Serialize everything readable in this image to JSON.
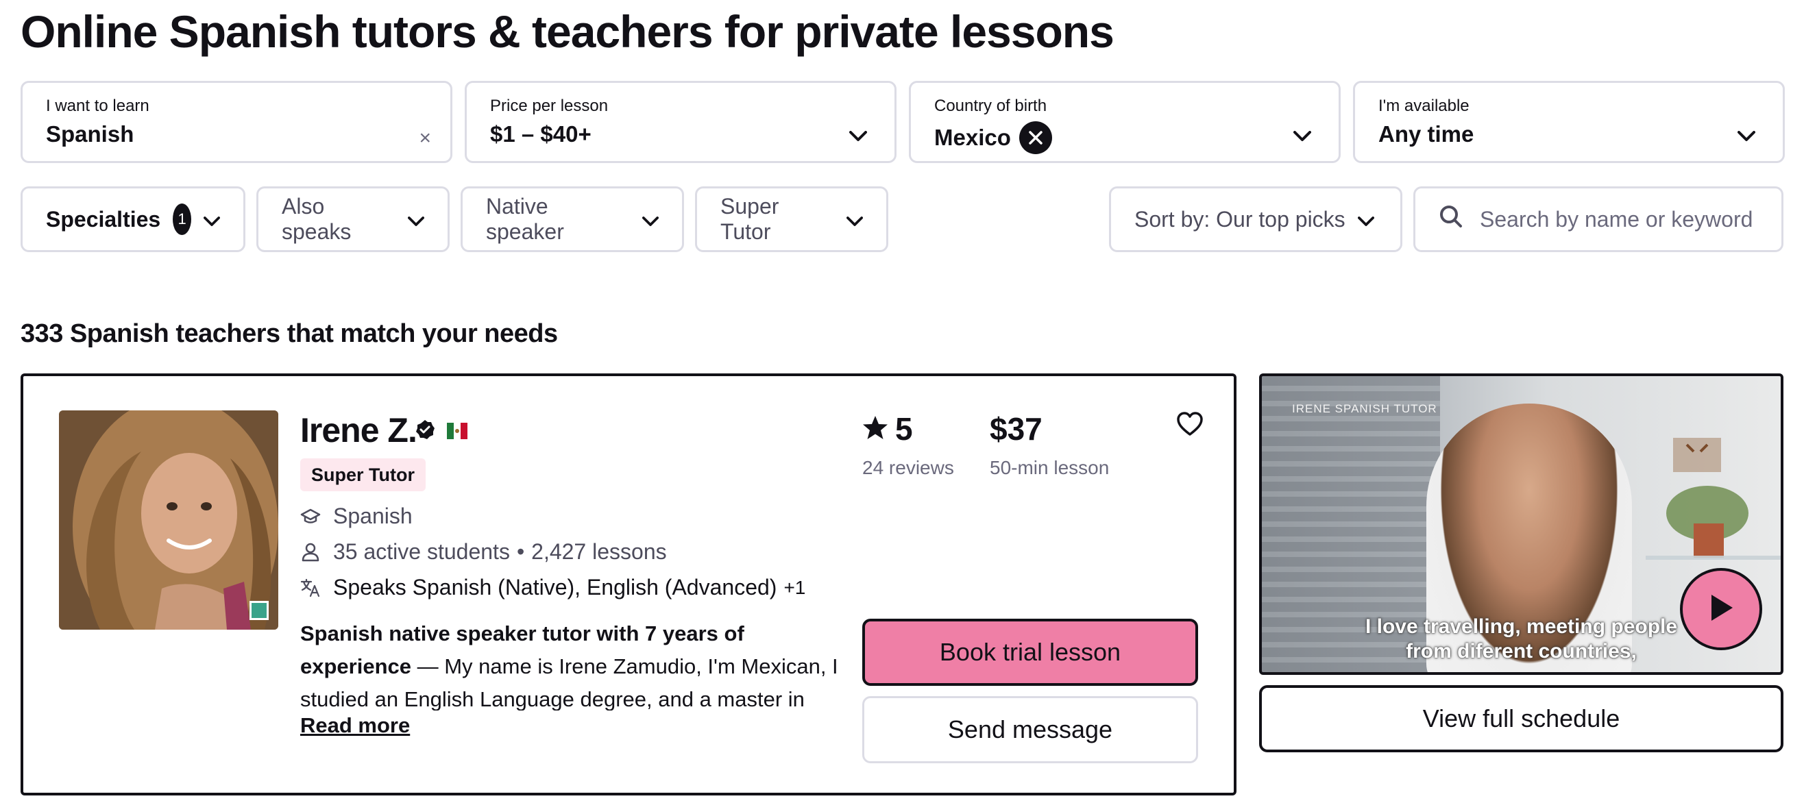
{
  "page": {
    "title": "Online Spanish tutors & teachers for private lessons",
    "match_count_text": "333 Spanish teachers that match your needs"
  },
  "filters": {
    "learn": {
      "label": "I want to learn",
      "value": "Spanish",
      "clear": "×"
    },
    "price": {
      "label": "Price per lesson",
      "value": "$1 – $40+"
    },
    "country": {
      "label": "Country of birth",
      "value": "Mexico"
    },
    "availability": {
      "label": "I'm available",
      "value": "Any time"
    }
  },
  "pills": {
    "specialties": {
      "label": "Specialties",
      "count": "1"
    },
    "also_speaks": "Also speaks",
    "native_speaker": "Native speaker",
    "super_tutor": "Super Tutor",
    "sort": "Sort by: Our top picks",
    "search_placeholder": "Search by name or keyword"
  },
  "tutor": {
    "name": "Irene Z.",
    "badge": "Super Tutor",
    "subject": "Spanish",
    "students": "35 active students",
    "separator": "•",
    "lessons": "2,427 lessons",
    "speaks": "Speaks Spanish (Native), English (Advanced)",
    "speaks_more": "+1",
    "headline": "Spanish native speaker tutor with 7 years of experience",
    "description": " — My name is Irene Zamudio, I'm Mexican, I studied an English Language degree, and a master in",
    "read_more": "Read more",
    "rating": "5",
    "reviews": "24 reviews",
    "price": "$37",
    "lesson_length": "50-min lesson",
    "book_label": "Book trial lesson",
    "message_label": "Send message"
  },
  "video": {
    "brand": "IRENE SPANISH TUTOR",
    "subtitle_line1": "I love travelling, meeting people",
    "subtitle_line2": "from diferent countries,",
    "schedule_label": "View full schedule"
  },
  "colors": {
    "accent_pink": "#ef7fa6",
    "tag_pink": "#fde8ee",
    "border_gray": "#dcdce5",
    "text_dark": "#121117",
    "online_green": "#3aa38a"
  },
  "icons": [
    "chevron-down-icon",
    "close-icon",
    "search-icon",
    "star-icon",
    "heart-icon",
    "verified-icon",
    "graduation-cap-icon",
    "person-icon",
    "translate-icon",
    "play-icon",
    "mexico-flag-icon"
  ]
}
